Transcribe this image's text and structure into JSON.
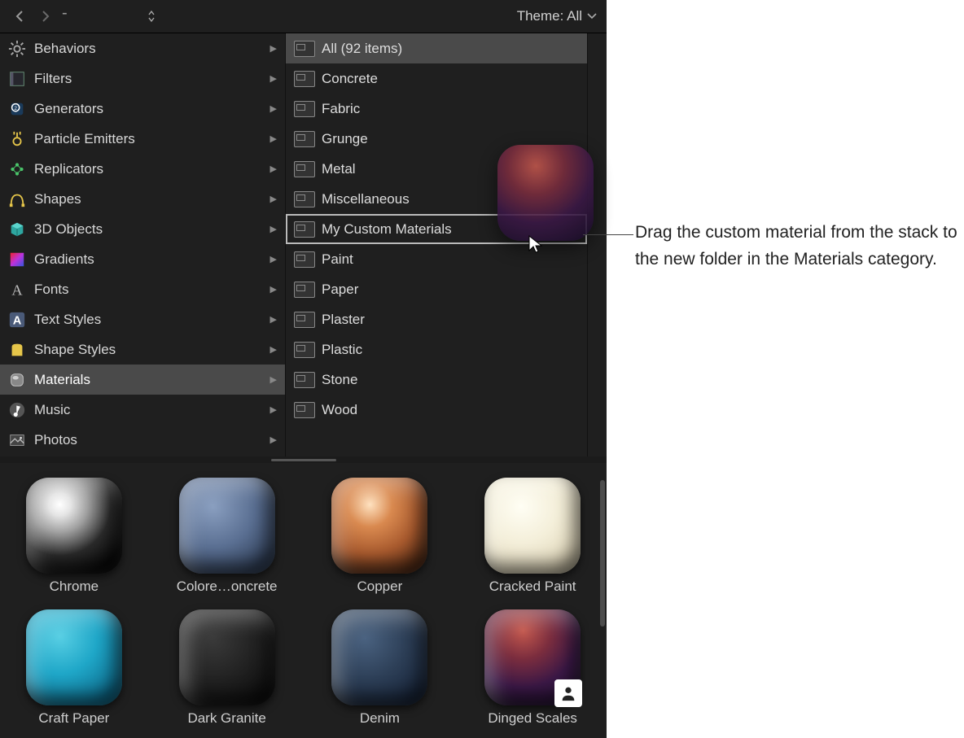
{
  "toolbar": {
    "theme_label": "Theme: All"
  },
  "categories": [
    {
      "label": "Behaviors",
      "icon": "gear"
    },
    {
      "label": "Filters",
      "icon": "filter"
    },
    {
      "label": "Generators",
      "icon": "gen"
    },
    {
      "label": "Particle Emitters",
      "icon": "particle"
    },
    {
      "label": "Replicators",
      "icon": "repl"
    },
    {
      "label": "Shapes",
      "icon": "shape"
    },
    {
      "label": "3D Objects",
      "icon": "cube"
    },
    {
      "label": "Gradients",
      "icon": "grad"
    },
    {
      "label": "Fonts",
      "icon": "fontA"
    },
    {
      "label": "Text Styles",
      "icon": "textA"
    },
    {
      "label": "Shape Styles",
      "icon": "shapestyle"
    },
    {
      "label": "Materials",
      "icon": "mat",
      "selected": true
    },
    {
      "label": "Music",
      "icon": "music"
    },
    {
      "label": "Photos",
      "icon": "photo"
    }
  ],
  "folders": [
    {
      "label": "All (92 items)",
      "selected": true
    },
    {
      "label": "Concrete"
    },
    {
      "label": "Fabric"
    },
    {
      "label": "Grunge"
    },
    {
      "label": "Metal"
    },
    {
      "label": "Miscellaneous"
    },
    {
      "label": "My Custom Materials",
      "drop": true
    },
    {
      "label": "Paint"
    },
    {
      "label": "Paper"
    },
    {
      "label": "Plaster"
    },
    {
      "label": "Plastic"
    },
    {
      "label": "Stone"
    },
    {
      "label": "Wood"
    }
  ],
  "thumbs": [
    {
      "label": "Chrome",
      "cls": "chrome"
    },
    {
      "label": "Colore…oncrete",
      "cls": "concrete"
    },
    {
      "label": "Copper",
      "cls": "copper"
    },
    {
      "label": "Cracked Paint",
      "cls": "cracked"
    },
    {
      "label": "Craft Paper",
      "cls": "craft"
    },
    {
      "label": "Dark Granite",
      "cls": "granite"
    },
    {
      "label": "Denim",
      "cls": "denim"
    },
    {
      "label": "Dinged Scales",
      "cls": "dinged",
      "user": true
    }
  ],
  "callout": "Drag the custom material from the stack to the new folder in the Materials category."
}
